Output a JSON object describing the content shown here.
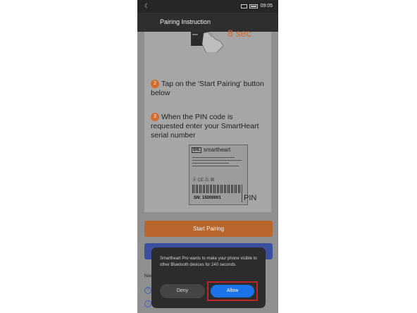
{
  "statusbar": {
    "time": "09:05"
  },
  "appbar": {
    "title": "Pairing Instruction"
  },
  "illustration": {
    "timer_text": "8 sec"
  },
  "steps": [
    {
      "number": "2",
      "text": "Tap on the 'Start Pairing' button below"
    },
    {
      "number": "3",
      "text": "When the PIN code is requested enter your SmartHeart serial number"
    }
  ],
  "serial_label": {
    "brand": "smartheart",
    "serial_number": "SN: 15000001",
    "pin_label": "PIN"
  },
  "buttons": {
    "start_pairing": "Start Pairing"
  },
  "help": {
    "partial_text": "Nee"
  },
  "dialog": {
    "message": "Smartheart Pro wants to make your phone visible to other Bluetooth devices for 240 seconds.",
    "deny": "Deny",
    "allow": "Allow"
  },
  "colors": {
    "accent_orange": "#d46a2c",
    "allow_blue": "#1a73e8",
    "highlight_red": "#c0242b"
  }
}
